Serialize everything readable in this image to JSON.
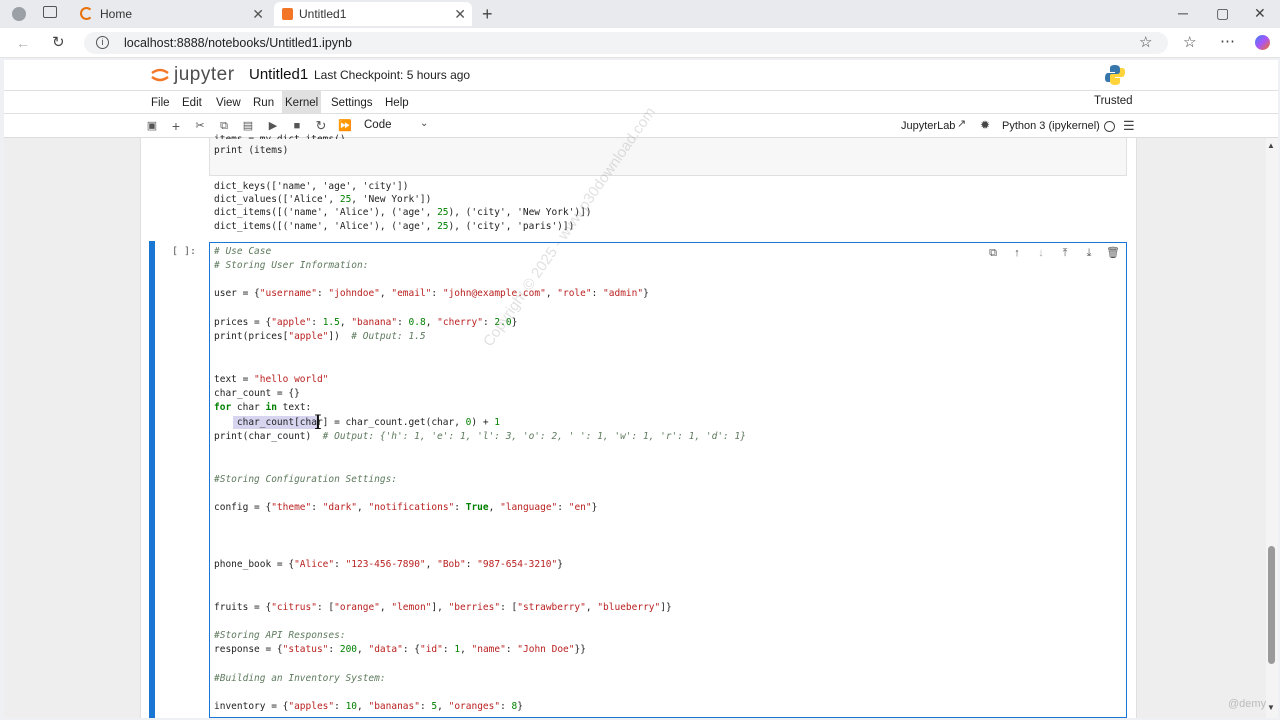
{
  "browser": {
    "tabs": [
      {
        "label": "Home",
        "close": "✕"
      },
      {
        "label": "Untitled1",
        "close": "✕"
      }
    ],
    "new_tab": "+",
    "url": "localhost:8888/notebooks/Untitled1.ipynb",
    "window_controls": {
      "minimize": "─",
      "maximize": "▢",
      "close": "✕"
    }
  },
  "jupyter": {
    "logo_text": "jupyter",
    "notebook_name": "Untitled1",
    "checkpoint": "Last Checkpoint: 5 hours ago",
    "trusted": "Trusted",
    "menu": [
      "File",
      "Edit",
      "View",
      "Run",
      "Kernel",
      "Settings",
      "Help"
    ],
    "active_menu": "Kernel",
    "cell_type": "Code",
    "jupyterlab_link": "JupyterLab",
    "kernel": "Python 3 (ipykernel)"
  },
  "cells": {
    "previous": {
      "input_partial": "items = my_dict.items()",
      "input_last": "print (items)",
      "output": [
        "dict_keys(['name', 'age', 'city'])",
        "dict_values(['Alice', 25, 'New York'])",
        "dict_items([('name', 'Alice'), ('age', 25), ('city', 'New York')])",
        "dict_items([('name', 'Alice'), ('age', 25), ('city', 'paris')])"
      ]
    },
    "active": {
      "prompt": "[ ]:",
      "lines": {
        "l01": "# Use Case",
        "l02": "# Storing User Information:",
        "l03": "user = {\"username\": \"johndoe\", \"email\": \"john@example.com\", \"role\": \"admin\"}",
        "l04": "prices = {\"apple\": 1.5, \"banana\": 0.8, \"cherry\": 2.0}",
        "l05": "print(prices[\"apple\"])  # Output: 1.5",
        "l06": "text = \"hello world\"",
        "l07": "char_count = {}",
        "l08": "for char in text:",
        "l09": "    char_count[char] = char_count.get(char, 0) + 1",
        "l10": "print(char_count)  # Output: {'h': 1, 'e': 1, 'l': 3, 'o': 2, ' ': 1, 'w': 1, 'r': 1, 'd': 1}",
        "l11": "#Storing Configuration Settings:",
        "l12": "config = {\"theme\": \"dark\", \"notifications\": True, \"language\": \"en\"}",
        "l13": "phone_book = {\"Alice\": \"123-456-7890\", \"Bob\": \"987-654-3210\"}",
        "l14": "fruits = {\"citrus\": [\"orange\", \"lemon\"], \"berries\": [\"strawberry\", \"blueberry\"]}",
        "l15": "#Storing API Responses:",
        "l16": "response = {\"status\": 200, \"data\": {\"id\": 1, \"name\": \"John Doe\"}}",
        "l17": "#Building an Inventory System:",
        "l18": "inventory = {\"apples\": 10, \"bananas\": 5, \"oranges\": 8}"
      }
    }
  },
  "watermark": "Copyright © 2025 - www.p30download.com",
  "corner_mark": "@demy"
}
